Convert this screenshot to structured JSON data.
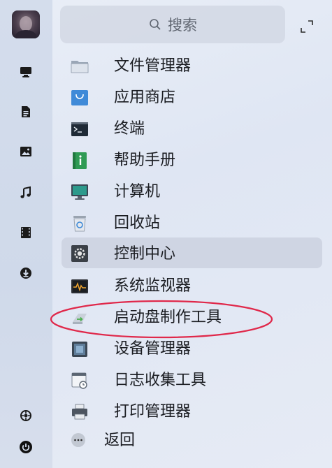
{
  "search": {
    "placeholder": "搜索",
    "icon": "search-icon"
  },
  "apps": [
    {
      "label": "文件管理器",
      "icon": "folder-icon"
    },
    {
      "label": "应用商店",
      "icon": "store-bag-icon"
    },
    {
      "label": "终端",
      "icon": "terminal-icon"
    },
    {
      "label": "帮助手册",
      "icon": "help-manual-icon"
    },
    {
      "label": "计算机",
      "icon": "monitor-icon"
    },
    {
      "label": "回收站",
      "icon": "trash-icon"
    },
    {
      "label": "控制中心",
      "icon": "gear-icon",
      "highlighted": true
    },
    {
      "label": "系统监视器",
      "icon": "system-monitor-icon"
    },
    {
      "label": "启动盘制作工具",
      "icon": "usb-drive-icon",
      "circled": true
    },
    {
      "label": "设备管理器",
      "icon": "device-manager-icon"
    },
    {
      "label": "日志收集工具",
      "icon": "log-collector-icon"
    },
    {
      "label": "打印管理器",
      "icon": "printer-icon"
    }
  ],
  "back": {
    "label": "返回",
    "icon": "more-dots-icon"
  },
  "colors": {
    "circle_annotation": "#e0284a",
    "highlight_row": "#cdd4e1"
  }
}
